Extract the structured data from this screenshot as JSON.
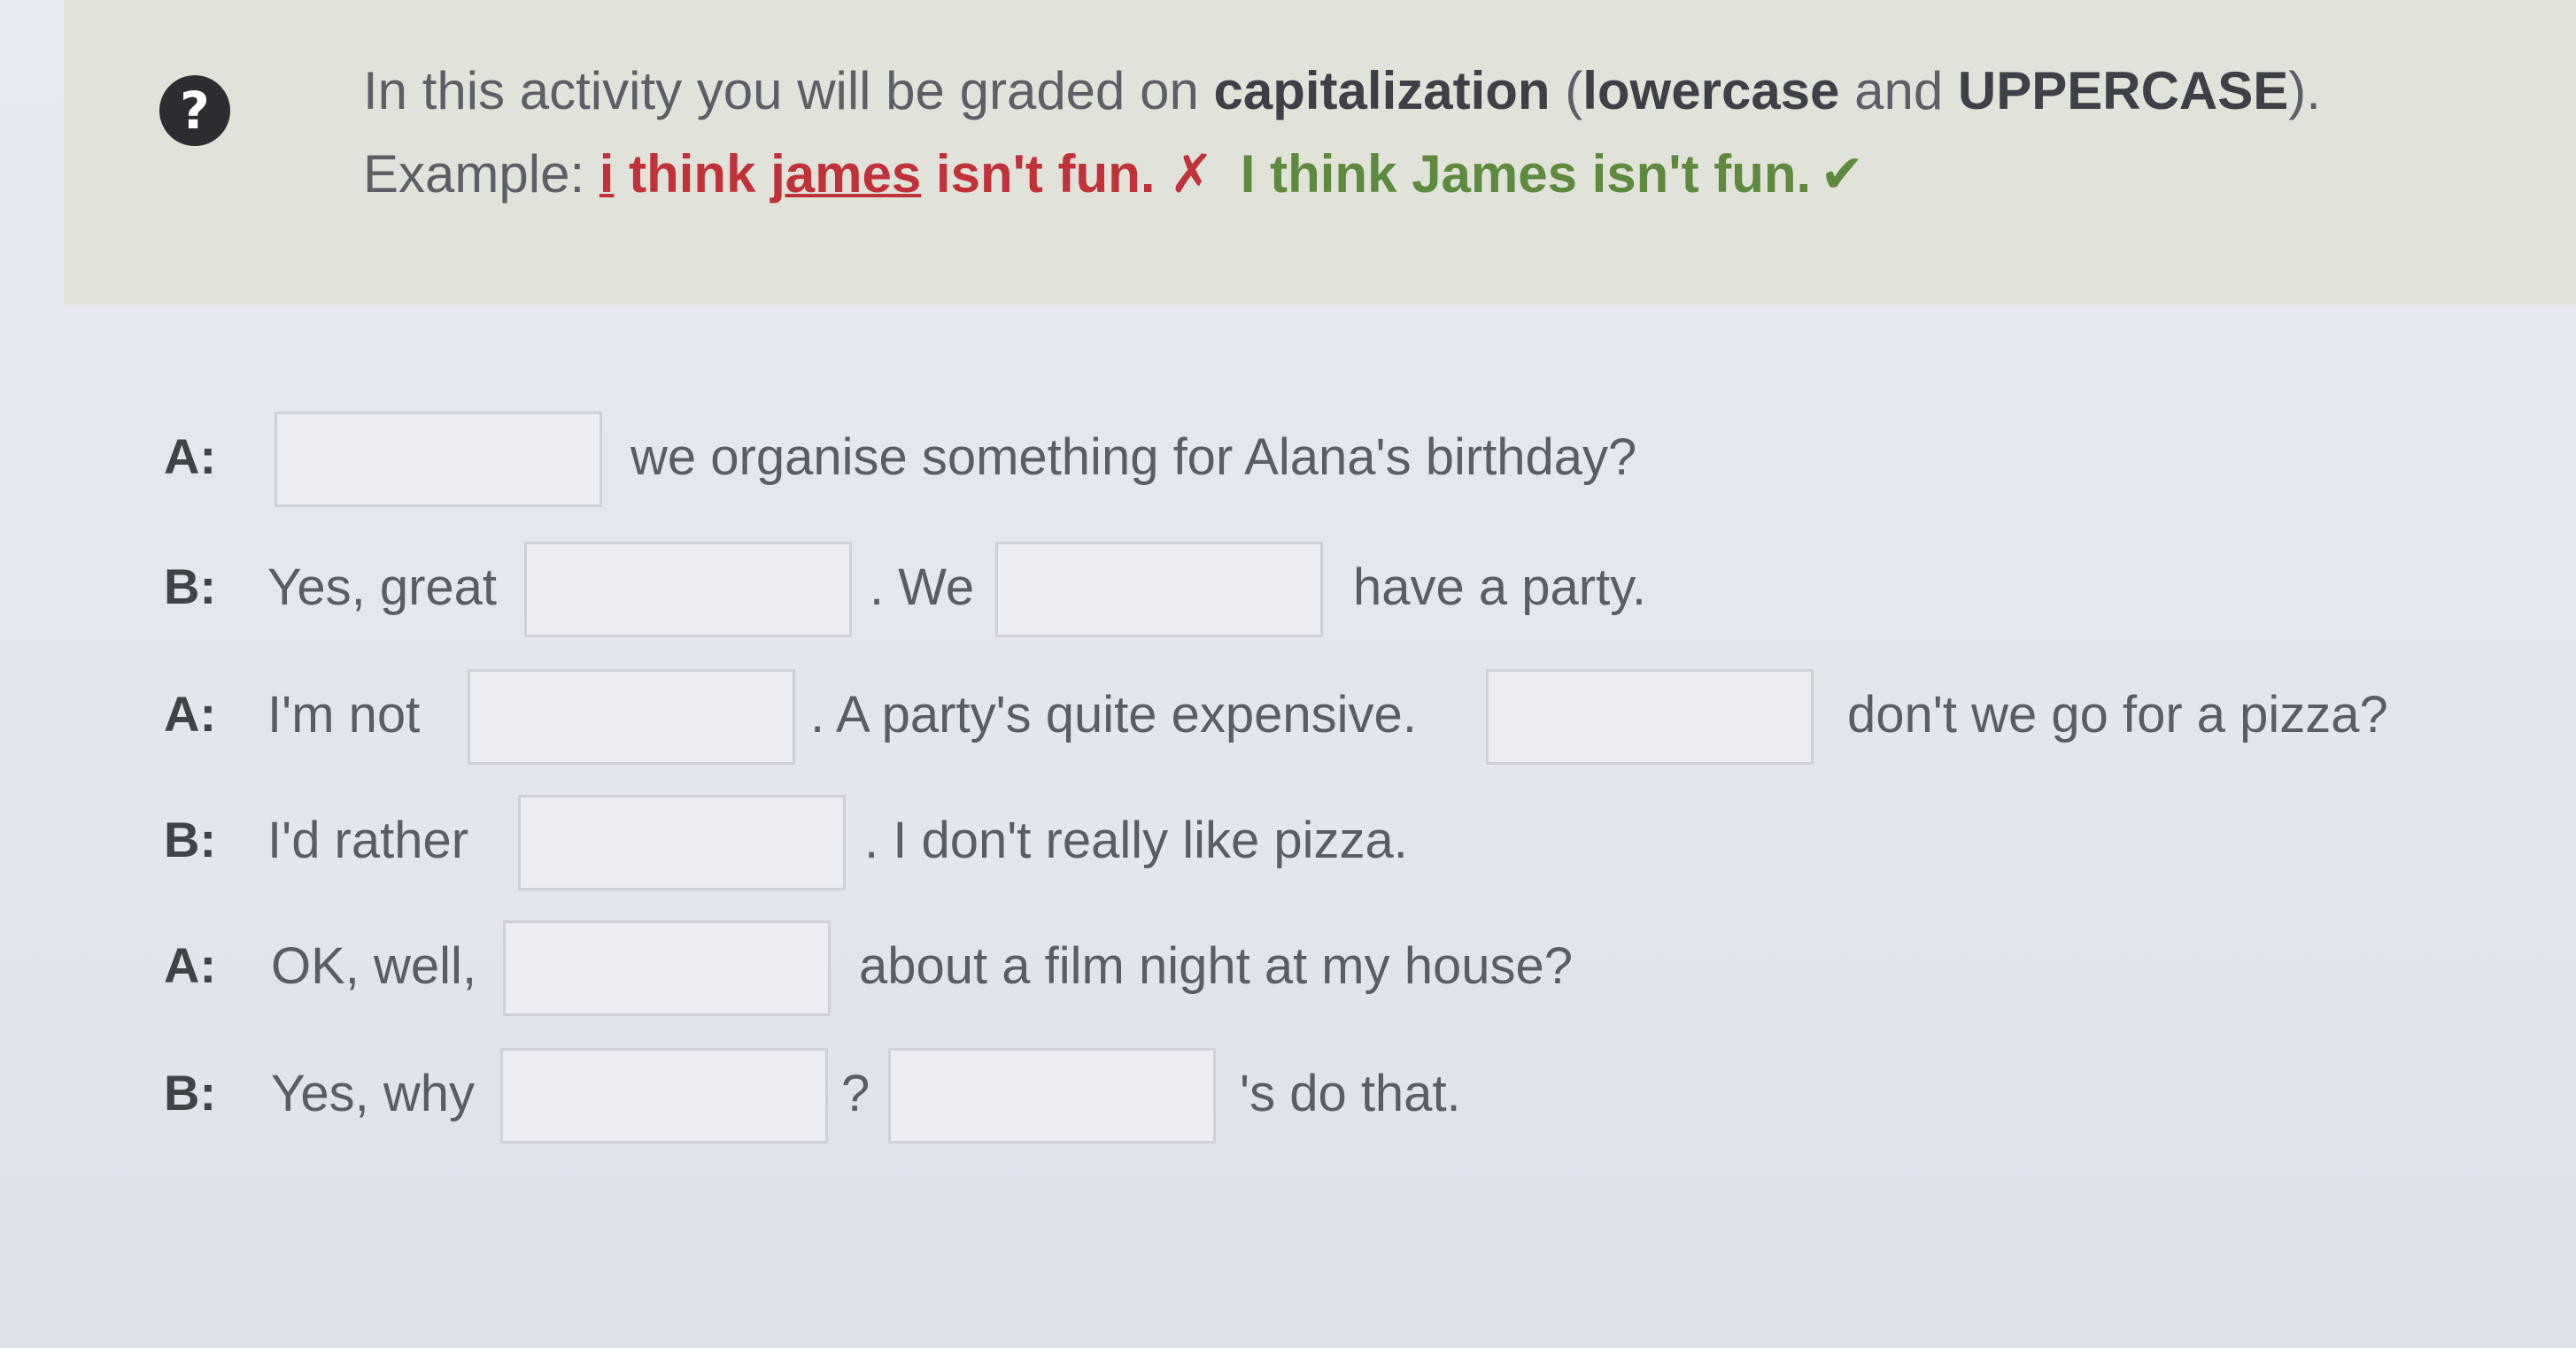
{
  "instructions": {
    "line1_prefix": "In this activity you will be graded on ",
    "line1_bold1": "capitalization",
    "line1_mid1": " (",
    "line1_bold2": "lowercase",
    "line1_mid2": " and ",
    "line1_bold3": "UPPERCASE",
    "line1_suffix": ").",
    "example_label": "Example: ",
    "wrong_word1": "i",
    "wrong_mid": " think ",
    "wrong_word2": "james",
    "wrong_tail": " isn't fun.",
    "wrong_mark": "✗",
    "right_sentence": "I think James isn't fun.",
    "right_mark": "✔"
  },
  "dialogue": [
    {
      "speaker": "A:",
      "text1": "we organise something for Alana's birthday?"
    },
    {
      "speaker": "B:",
      "pre": "Yes, great",
      "text1": ". We",
      "text2": "have a party."
    },
    {
      "speaker": "A:",
      "pre": "I'm not",
      "text1": ". A party's quite expensive.",
      "text2": "don't we go for a pizza?"
    },
    {
      "speaker": "B:",
      "pre": "I'd rather",
      "text1": ". I don't really like pizza."
    },
    {
      "speaker": "A:",
      "pre": "OK, well,",
      "text1": "about a film night at my house?"
    },
    {
      "speaker": "B:",
      "pre": "Yes, why",
      "text1": "?",
      "text2": "'s do that."
    }
  ],
  "colors": {
    "error_red": "#c0313a",
    "correct_green": "#5d8a3c",
    "banner_bg": "#e1e3db",
    "page_bg": "#e3e6ee"
  },
  "icons": {
    "help": "question-mark-circle-icon"
  }
}
